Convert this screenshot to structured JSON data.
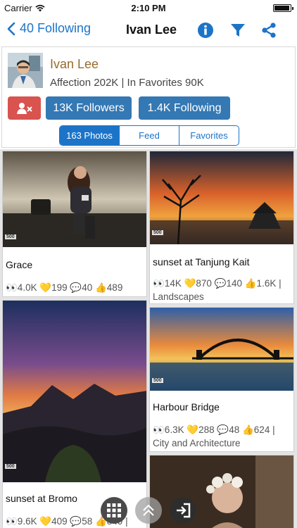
{
  "status_bar": {
    "carrier": "Carrier",
    "time": "2:10 PM",
    "battery_level": 0.95
  },
  "nav": {
    "back_label": "40 Following",
    "title": "Ivan Lee",
    "icons": [
      "info-icon",
      "filter-icon",
      "share-icon"
    ]
  },
  "profile": {
    "name": "Ivan Lee",
    "stats": "Affection 202K | In Favorites 90K",
    "unfollow_icon": "remove-user-icon",
    "followers_button": "13K Followers",
    "following_button": "1.4K Following",
    "tabs": [
      {
        "label": "163 Photos",
        "active": true
      },
      {
        "label": "Feed",
        "active": false
      },
      {
        "label": "Favorites",
        "active": false
      }
    ]
  },
  "photos": [
    {
      "title": "Grace",
      "meta": "👀4.0K 💛199 💬40 👍489"
    },
    {
      "title": "sunset at Tanjung Kait",
      "meta": "👀14K 💛870 💬140 👍1.6K | Landscapes"
    },
    {
      "title": "Harbour Bridge",
      "meta": "👀6.3K 💛288 💬48 👍624 | City and Architecture"
    },
    {
      "title": "sunset at Bromo",
      "meta": "👀9.6K 💛409 💬58 👍849 |"
    }
  ],
  "watermark": "500",
  "colors": {
    "accent": "#1c74c8",
    "danger": "#d9534f",
    "button_blue": "#3478b4",
    "name": "#9a6a2c"
  },
  "floating_buttons": [
    "grid-menu-icon",
    "scroll-top-icon",
    "logout-icon"
  ]
}
